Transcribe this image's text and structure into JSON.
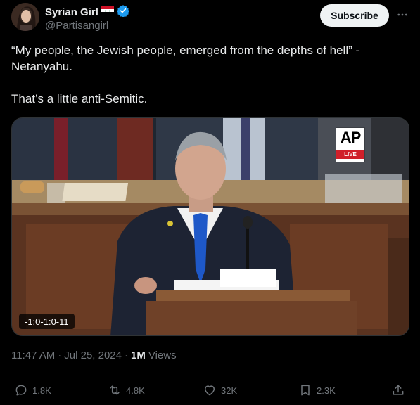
{
  "author": {
    "display_name": "Syrian Girl",
    "handle": "@Partisangirl",
    "flag_icon": "syria-flag-icon",
    "verified_icon": "verified-badge-icon",
    "verified_color": "#1d9bf0"
  },
  "header": {
    "subscribe_label": "Subscribe",
    "more_icon": "more-options-icon"
  },
  "tweet": {
    "paragraphs": [
      "“My people, the Jewish people, emerged from the depths of hell” - Netanyahu.",
      "That’s a little anti-Semitic."
    ]
  },
  "media": {
    "watermark": "AP",
    "live_label": "LIVE",
    "timestamp": "-1:0-1:0-11"
  },
  "meta": {
    "time": "11:47 AM",
    "date": "Jul 25, 2024",
    "views_count": "1M",
    "views_label": "Views"
  },
  "actions": {
    "replies": "1.8K",
    "reposts": "4.8K",
    "likes": "32K",
    "bookmarks": "2.3K"
  },
  "colors": {
    "background": "#000000",
    "text": "#e7e9ea",
    "secondary": "#71767b",
    "border": "#2f3336",
    "accent": "#1d9bf0"
  }
}
